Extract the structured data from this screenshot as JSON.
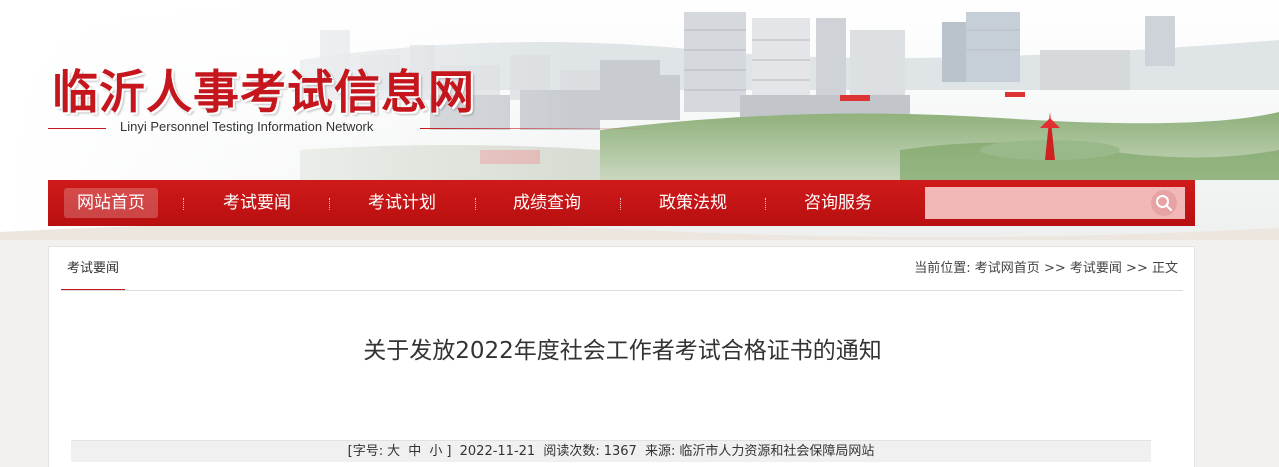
{
  "site": {
    "title": "临沂人事考试信息网",
    "subtitle": "Linyi Personnel Testing Information Network"
  },
  "nav": {
    "items": [
      {
        "label": "网站首页",
        "active": true
      },
      {
        "label": "考试要闻",
        "active": false
      },
      {
        "label": "考试计划",
        "active": false
      },
      {
        "label": "成绩查询",
        "active": false
      },
      {
        "label": "政策法规",
        "active": false
      },
      {
        "label": "咨询服务",
        "active": false
      }
    ],
    "search": {
      "value": "",
      "placeholder": ""
    },
    "search_icon": "search-icon"
  },
  "panel": {
    "tab_label": "考试要闻",
    "breadcrumb": {
      "prefix": "当前位置:",
      "home": "考试网首页",
      "sep1": ">>",
      "section": "考试要闻",
      "sep2": ">>",
      "current": "正文"
    }
  },
  "article": {
    "title": "关于发放2022年度社会工作者考试合格证书的通知",
    "meta": {
      "font_prefix": "[字号:",
      "font_large": "大",
      "font_medium": "中",
      "font_small": "小",
      "font_suffix": "]",
      "date": "2022-11-21",
      "views_label": "阅读次数:",
      "views": "1367",
      "source_label": "来源:",
      "source": "临沂市人力资源和社会保障局网站"
    }
  },
  "colors": {
    "brand_red": "#c4161c",
    "nav_red": "#c01414",
    "search_bg": "#f2b8b8"
  }
}
